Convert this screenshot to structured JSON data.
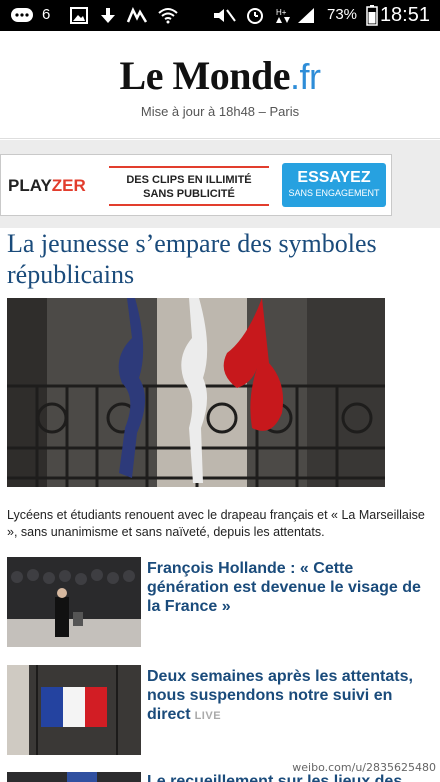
{
  "status_bar": {
    "notification_count": "6",
    "battery_percent": "73%",
    "time": "18:51"
  },
  "header": {
    "logo_main": "Le Monde",
    "logo_suffix": ".fr",
    "update_text": "Mise à jour à 18h48 – Paris"
  },
  "ad": {
    "brand_play": "PLAY",
    "brand_zer": "ZER",
    "text_line1": "DES CLIPS EN ILLIMITÉ",
    "text_line2": "SANS PUBLICITÉ",
    "cta_label": "ESSAYEZ",
    "cta_sub": "SANS ENGAGEMENT"
  },
  "main_article": {
    "headline": "La jeunesse s’empare des symboles républicains",
    "caption": "Lycéens et étudiants renouent avec le drapeau français et « La Marseillaise », sans unanimisme et sans naïveté, depuis les attentats."
  },
  "articles": [
    {
      "title": "François Hollande : « Cette génération est devenue le visage de la France »"
    },
    {
      "title": "Deux semaines après les attentats, nous suspendons notre suivi en direct",
      "badge": "LIVE"
    },
    {
      "title": "Le recueillement sur les lieux des"
    }
  ],
  "watermark": "weibo.com/u/2835625480"
}
